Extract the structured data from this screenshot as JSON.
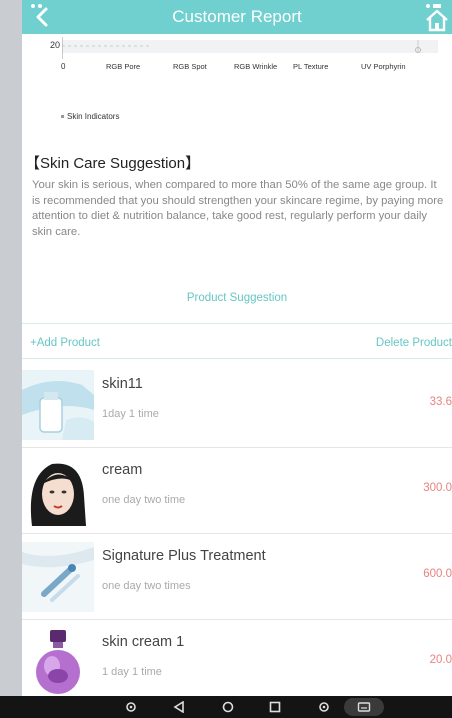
{
  "header": {
    "title": "Customer Report"
  },
  "chart_data": {
    "type": "bar",
    "y_tick_visible": "20",
    "zero_label": "0",
    "categories": [
      "RGB Pore",
      "RGB Spot",
      "RGB Wrinkle",
      "PL Texture",
      "UV Porphyrin"
    ],
    "legend": "Skin Indicators"
  },
  "suggestion": {
    "title": "【Skin Care Suggestion】",
    "text": "Your skin is serious, when compared to more than 50% of the same age group. It is recommended that you should strengthen your skincare regime, by paying more attention to diet & nutrition balance, take good rest, regularly perform your daily skin care."
  },
  "product_suggestion": "Product Suggestion",
  "toolbar": {
    "add_label": "+Add Product",
    "delete_label": "Delete Product"
  },
  "products": [
    {
      "name": "skin11",
      "frequency": "1day 1 time",
      "price": "33.6"
    },
    {
      "name": "cream",
      "frequency": "one day two time",
      "price": "300.0"
    },
    {
      "name": "Signature Plus Treatment",
      "frequency": "one day two times",
      "price": "600.0"
    },
    {
      "name": "skin cream 1",
      "frequency": "1 day 1 time",
      "price": "20.0"
    }
  ],
  "colors": {
    "header": "#6fd0cf",
    "accent": "#66c6c5",
    "price": "#e8837e"
  },
  "icons": {
    "back": "chevron-left-icon",
    "home": "home-icon"
  }
}
